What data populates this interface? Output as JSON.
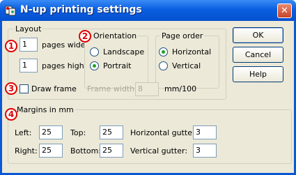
{
  "window": {
    "title": "N-up printing settings"
  },
  "layout": {
    "group_title": "Layout",
    "pages_wide_value": "1",
    "pages_wide_label": "pages wide",
    "pages_high_value": "1",
    "pages_high_label": "pages high"
  },
  "orientation": {
    "group_title": "Orientation",
    "options": [
      "Landscape",
      "Portrait"
    ],
    "selected": "Portrait"
  },
  "page_order": {
    "group_title": "Page order",
    "options": [
      "Horizontal",
      "Vertical"
    ],
    "selected": "Horizontal"
  },
  "frame": {
    "checkbox_label": "Draw frame",
    "checked": false,
    "width_label": "Frame width:",
    "width_value": "8",
    "width_unit": "mm/100"
  },
  "margins": {
    "group_title": "Margins in mm",
    "left_label": "Left:",
    "left_value": "25",
    "top_label": "Top:",
    "top_value": "25",
    "hgutter_label": "Horizontal gutter:",
    "hgutter_value": "3",
    "right_label": "Right:",
    "right_value": "25",
    "bottom_label": "Bottom:",
    "bottom_value": "25",
    "vgutter_label": "Vertical gutter:",
    "vgutter_value": "3"
  },
  "buttons": {
    "ok": "OK",
    "cancel": "Cancel",
    "help": "Help"
  },
  "markers": [
    "1",
    "2",
    "3",
    "4"
  ],
  "colors": {
    "titlebar": "#0a5fe0",
    "marker": "#e00000",
    "dialog_bg": "#ece9d8"
  },
  "icons": {
    "app": "app-icon",
    "close": "close-icon"
  }
}
